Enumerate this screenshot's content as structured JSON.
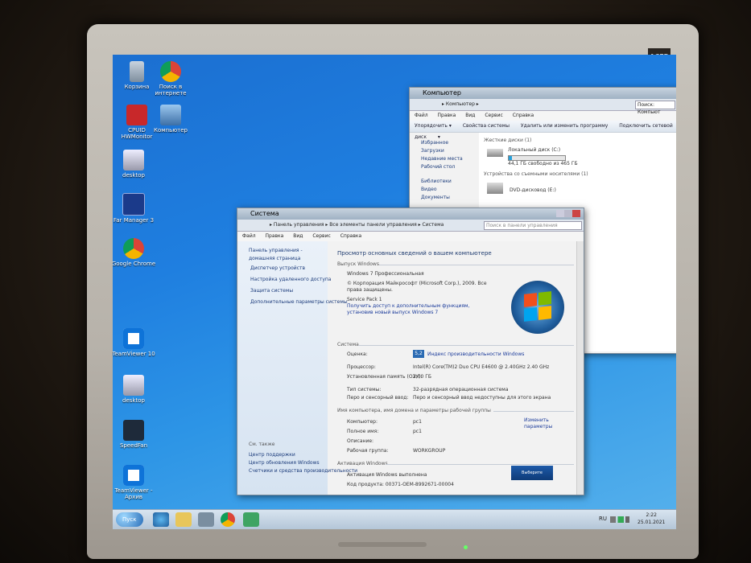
{
  "monitor": {
    "logo": "ACER"
  },
  "desktop": {
    "icons": [
      {
        "label": "Корзина"
      },
      {
        "label": "Поиск в интернете"
      },
      {
        "label": "CPUID HWMonitor"
      },
      {
        "label": "Компьютер"
      },
      {
        "label": "desktop"
      },
      {
        "label": "Far Manager 3"
      },
      {
        "label": "Google Chrome"
      },
      {
        "label": "TeamViewer 10"
      },
      {
        "label": "desktop"
      },
      {
        "label": "SpeedFan"
      },
      {
        "label": "TeamViewer - Архив"
      }
    ]
  },
  "computer_window": {
    "title": "Компьютер",
    "address": "▸ Компьютер ▸",
    "search_placeholder": "Поиск: Компьют",
    "menu": [
      "Файл",
      "Правка",
      "Вид",
      "Сервис",
      "Справка"
    ],
    "toolbar": [
      "Упорядочить ▾",
      "Свойства системы",
      "Удалить или изменить программу",
      "Подключить сетевой диск",
      "▾"
    ],
    "nav": [
      "Избранное",
      "Загрузки",
      "Недавние места",
      "Рабочий стол",
      "Библиотеки",
      "Видео",
      "Документы"
    ],
    "section_disks": "Жесткие диски (1)",
    "disk_label": "Локальный диск (C:)",
    "disk_free": "44,1 ГБ свободно из 465 ГБ",
    "disk_fill": 0.05,
    "section_removable": "Устройства со съемными носителями (1)",
    "dvd_label": "DVD-дисковод (E:)"
  },
  "system_window": {
    "title": "Система",
    "address": "▸ Панель управления ▸ Все элементы панели управления ▸ Система",
    "search_placeholder": "Поиск в панели управления",
    "menu": [
      "Файл",
      "Правка",
      "Вид",
      "Сервис",
      "Справка"
    ],
    "nav_home": "Панель управления - домашняя страница",
    "nav_links": [
      "Диспетчер устройств",
      "Настройка удаленного доступа",
      "Защита системы",
      "Дополнительные параметры системы"
    ],
    "see_also": "См. также",
    "see_also_links": [
      "Центр поддержки",
      "Центр обновления Windows",
      "Счетчики и средства производительности"
    ],
    "heading": "Просмотр основных сведений о вашем компьютере",
    "edition_section": "Выпуск Windows",
    "edition": "Windows 7 Профессиональная",
    "copyright": "© Корпорация Майкрософт (Microsoft Corp.), 2009. Все права защищены.",
    "service_pack": "Service Pack 1",
    "sp_link": "Получить доступ к дополнительным функциям, установив новый выпуск Windows 7",
    "system_section": "Система",
    "rows": [
      {
        "k": "Оценка:",
        "v": "Индекс производительности Windows"
      },
      {
        "k": "Процессор:",
        "v": "Intel(R) Core(TM)2 Duo CPU     E4600  @ 2.40GHz   2.40 GHz"
      },
      {
        "k": "Установленная память (ОЗУ):",
        "v": "2,00 ГБ"
      },
      {
        "k": "Тип системы:",
        "v": "32-разрядная операционная система"
      },
      {
        "k": "Перо и сенсорный ввод:",
        "v": "Перо и сенсорный ввод недоступны для этого экрана"
      }
    ],
    "score": "5,2",
    "name_section": "Имя компьютера, имя домена и параметры рабочей группы",
    "name_rows": [
      {
        "k": "Компьютер:",
        "v": "pc1"
      },
      {
        "k": "Полное имя:",
        "v": "pc1"
      },
      {
        "k": "Описание:",
        "v": ""
      },
      {
        "k": "Рабочая группа:",
        "v": "WORKGROUP"
      }
    ],
    "change_params": "Изменить параметры",
    "activation_section": "Активация Windows",
    "activation_text": "Активация Windows выполнена",
    "product_code": "Код продукта: 00371-OEM-8992671-00004",
    "genuine": "Выберите настоящее"
  },
  "taskbar": {
    "start": "Пуск",
    "lang": "RU",
    "time": "2:22",
    "date": "25.01.2021"
  }
}
